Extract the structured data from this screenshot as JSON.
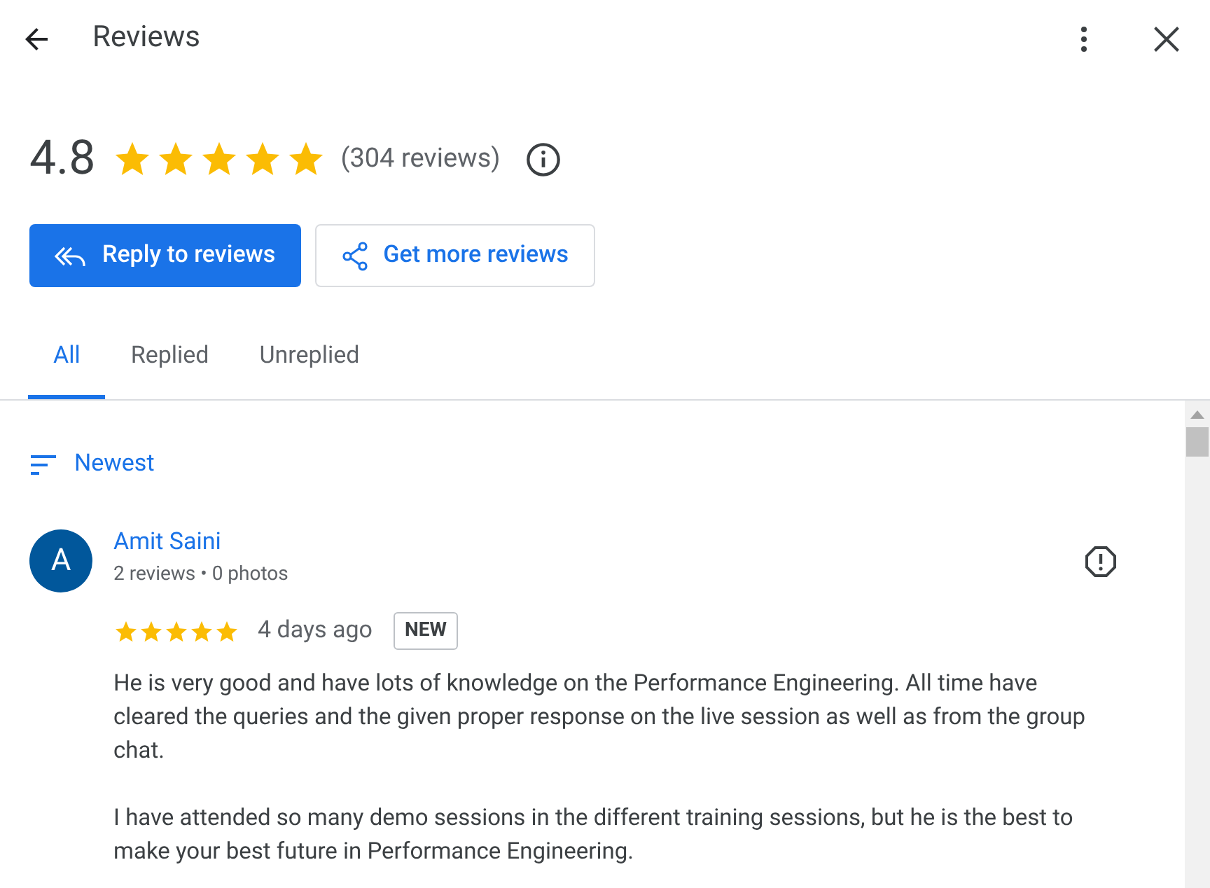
{
  "header": {
    "title": "Reviews"
  },
  "summary": {
    "rating": "4.8",
    "stars": 5,
    "count": "(304 reviews)"
  },
  "buttons": [
    {
      "kind": "primary",
      "label": "Reply to reviews"
    },
    {
      "kind": "outline",
      "label": "Get more reviews"
    }
  ],
  "tabs": [
    {
      "label": "All",
      "selected": true
    },
    {
      "label": "Replied",
      "selected": false
    },
    {
      "label": "Unreplied",
      "selected": false
    }
  ],
  "sort": {
    "label": "Newest"
  },
  "reviews": [
    {
      "initial": "A",
      "name": "Amit Saini",
      "meta": "2 reviews • 0 photos",
      "stars": 5,
      "time": "4 days ago",
      "badge": "NEW",
      "paragraphs": [
        "He is very good and have lots of knowledge on the Performance Engineering. All time have cleared the queries and the given proper response on the live session as well as from the group chat.",
        "I have attended so many demo sessions in the different training sessions, but he is the best to make your best future in Performance Engineering."
      ]
    }
  ]
}
